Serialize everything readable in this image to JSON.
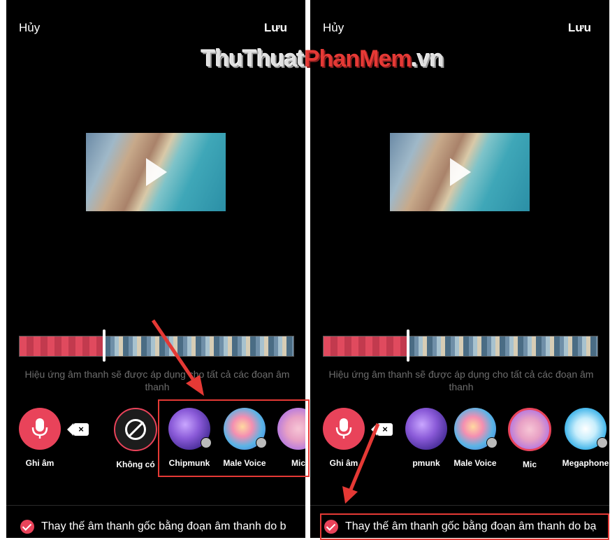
{
  "watermark": {
    "part1": "ThuThuat",
    "part2": "PhanMem",
    "part3": ".vn"
  },
  "colors": {
    "accent": "#e9435a",
    "annotation": "#e53935",
    "background": "#000000"
  },
  "panels": [
    {
      "header": {
        "cancel": "Hủy",
        "save": "Lưu"
      },
      "hint": "Hiệu ứng âm thanh sẽ được áp dụng cho tất cả các đoạn âm thanh",
      "timeline_progress": 0.31,
      "effects": [
        {
          "label": "Ghi âm",
          "icon": "microphone-icon"
        },
        {
          "label": "Không có",
          "icon": "none-icon"
        },
        {
          "label": "Chipmunk",
          "icon": "chipmunk-icon"
        },
        {
          "label": "Male Voice",
          "icon": "male-voice-icon"
        },
        {
          "label": "Mic",
          "icon": "mic-effect-icon"
        }
      ],
      "replace_text": "Thay thế âm thanh gốc bằng đoạn âm thanh do b"
    },
    {
      "header": {
        "cancel": "Hủy",
        "save": "Lưu"
      },
      "hint": "Hiệu ứng âm thanh sẽ được áp dụng cho tất cả các đoạn âm thanh",
      "timeline_progress": 0.31,
      "effects": [
        {
          "label": "Ghi âm",
          "icon": "microphone-icon"
        },
        {
          "label": "pmunk",
          "icon": "chipmunk-icon"
        },
        {
          "label": "Male Voice",
          "icon": "male-voice-icon"
        },
        {
          "label": "Mic",
          "icon": "mic-effect-icon",
          "selected": true
        },
        {
          "label": "Megaphone",
          "icon": "megaphone-icon"
        }
      ],
      "replace_text": "Thay thế âm thanh gốc bằng đoạn âm thanh do bạ"
    }
  ]
}
